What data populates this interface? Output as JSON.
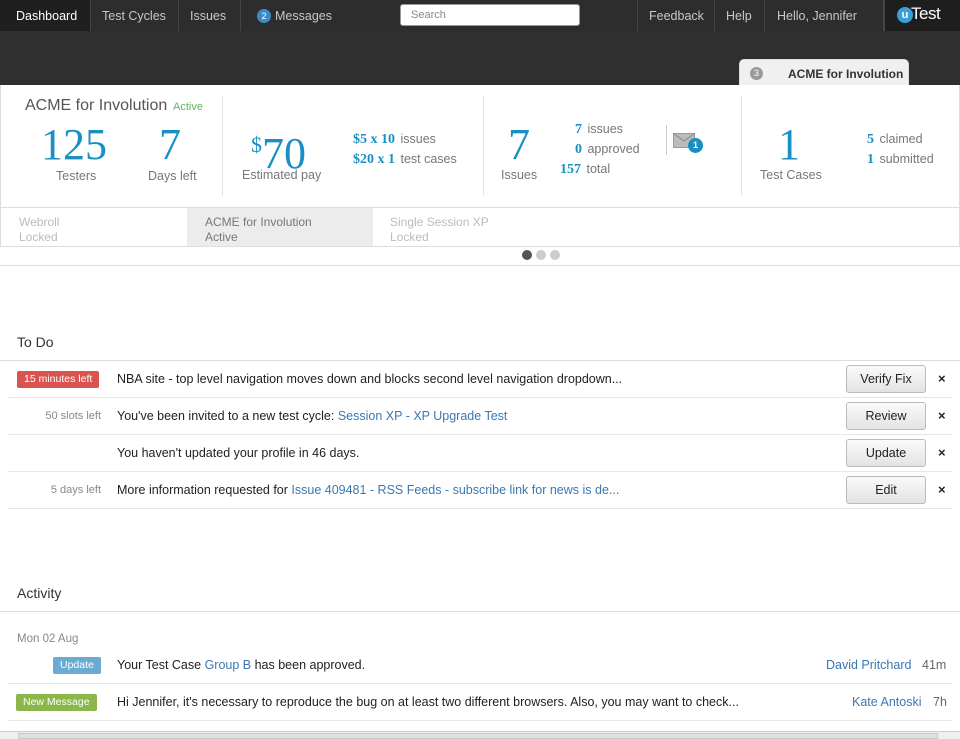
{
  "nav": {
    "dashboard": "Dashboard",
    "test_cycles": "Test Cycles",
    "issues": "Issues",
    "messages_count": "2",
    "messages": "Messages",
    "search_placeholder": "Search",
    "feedback": "Feedback",
    "help": "Help",
    "greeting": "Hello, Jennifer",
    "logo_u": "u",
    "logo_text": "Test"
  },
  "project_tab": {
    "count": "3",
    "label": "ACME for Involution"
  },
  "stats": {
    "project_name": "ACME for Involution",
    "project_status": "Active",
    "testers": "125",
    "testers_label": "Testers",
    "days_left": "7",
    "days_left_label": "Days left",
    "pay_symbol": "$",
    "pay": "70",
    "pay_label": "Estimated pay",
    "issue_rate": "$5 x 10",
    "issue_rate_label": "issues",
    "case_rate": "$20 x 1",
    "case_rate_label": "test cases",
    "issues": "7",
    "issues_label": "Issues",
    "issues_count": "7",
    "issues_count_label": "issues",
    "approved": "0",
    "approved_label": "approved",
    "total": "157",
    "total_label": "total",
    "mail_count": "1",
    "test_cases": "1",
    "test_cases_label": "Test Cases",
    "claimed": "5",
    "claimed_label": "claimed",
    "submitted": "1",
    "submitted_label": "submitted"
  },
  "cycles": [
    {
      "name": "Webroll",
      "status": "Locked"
    },
    {
      "name": "ACME for Involution",
      "status": "Active"
    },
    {
      "name": "Single Session XP",
      "status": "Locked"
    }
  ],
  "todo": {
    "title": "To Do",
    "items": [
      {
        "meta": "15 minutes left",
        "text": "NBA site - top level navigation moves down and blocks second level navigation dropdown...",
        "link": "",
        "button": "Verify Fix",
        "close": "×"
      },
      {
        "meta": "50 slots left",
        "text": "You've been invited to a new test cycle: ",
        "link": "Session XP - XP Upgrade Test",
        "button": "Review",
        "close": "×"
      },
      {
        "meta": "",
        "text": "You haven't updated your profile in 46 days.",
        "link": "",
        "button": "Update",
        "close": "×"
      },
      {
        "meta": "5 days left",
        "text": "More information requested for ",
        "link": "Issue 409481 - RSS Feeds - subscribe link for news is de...",
        "button": "Edit",
        "close": "×"
      }
    ]
  },
  "activity": {
    "title": "Activity",
    "date": "Mon 02 Aug",
    "items": [
      {
        "tag": "Update",
        "text_before": "Your Test Case ",
        "link": "Group B",
        "text_after": " has been approved.",
        "author": "David Pritchard",
        "ago": "41m"
      },
      {
        "tag": "New Message",
        "text_before": "Hi Jennifer, it's necessary to reproduce the bug on at least two different browsers. Also, you may want to check...",
        "link": "",
        "text_after": "",
        "author": "Kate Antoski",
        "ago": "7h"
      }
    ]
  },
  "colors": {
    "accent": "#1a8fc2",
    "link": "#3b77b3",
    "urgent": "#d9534f",
    "update": "#6aabd2",
    "message": "#8bb74a"
  }
}
